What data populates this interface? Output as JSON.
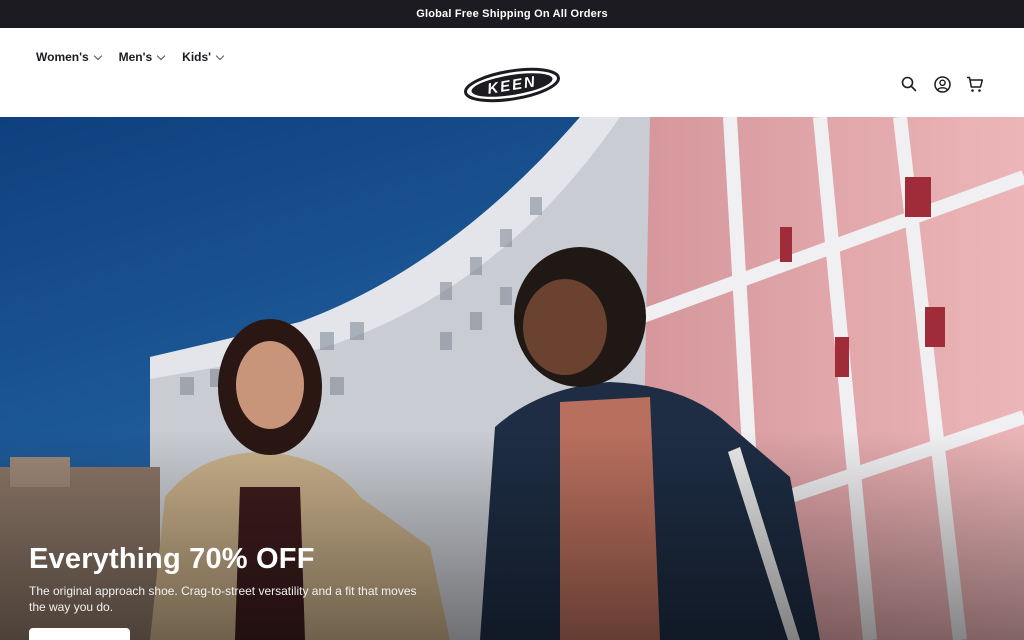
{
  "announcement": {
    "text": "Global Free Shipping On All Orders"
  },
  "nav": {
    "items": [
      {
        "label": "Women's"
      },
      {
        "label": "Men's"
      },
      {
        "label": "Kids'"
      }
    ]
  },
  "logo": {
    "text": "KEEN"
  },
  "header_icons": [
    "search-icon",
    "account-icon",
    "cart-icon"
  ],
  "hero": {
    "title": "Everything 70% OFF",
    "description": "The original approach shoe. Crag-to-street versatility and a fit that moves the way you do."
  },
  "colors": {
    "announce_bg": "#1c1b21",
    "sky": "#1e5a9a",
    "building_pink": "#e3a8ad"
  }
}
